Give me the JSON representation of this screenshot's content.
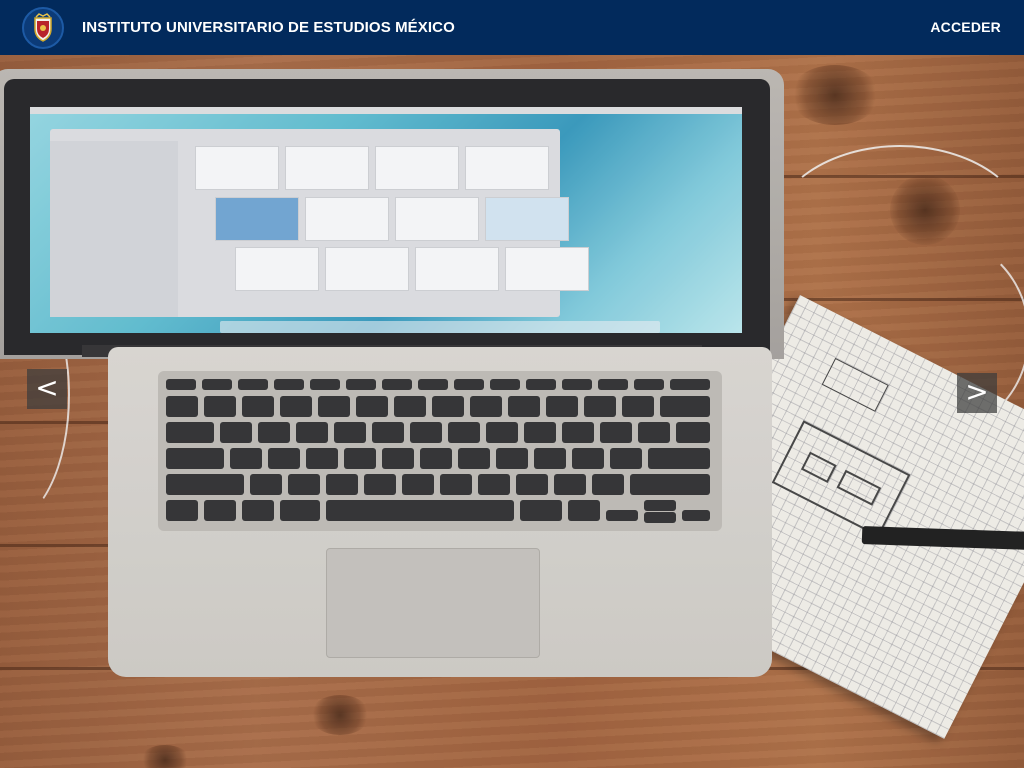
{
  "header": {
    "title": "INSTITUTO UNIVERSITARIO DE ESTUDIOS MÉXICO",
    "login_label": "ACCEDER",
    "logo_icon": "shield-crest-icon",
    "background_color": "#022a5c"
  },
  "carousel": {
    "prev_label": "<",
    "next_label": ">",
    "prev_icon": "chevron-left-icon",
    "next_icon": "chevron-right-icon",
    "slide_image": "laptop-on-wooden-desk-photo"
  }
}
